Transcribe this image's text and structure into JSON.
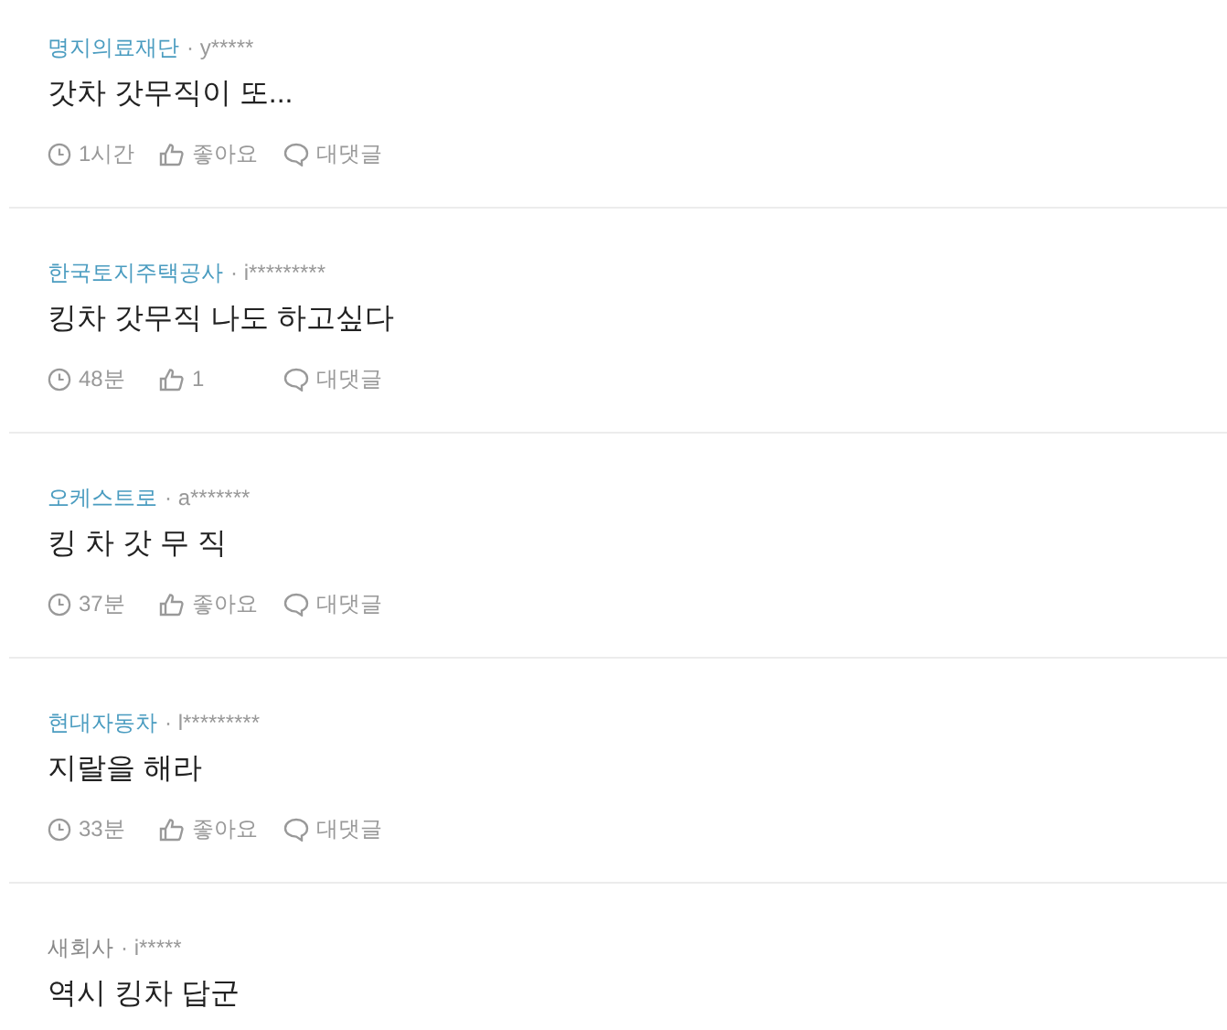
{
  "comments": [
    {
      "company": "명지의료재단",
      "color": "#4a9cc0",
      "author": "· y*****",
      "text": "갓차 갓무직이 또...",
      "time": "1시간",
      "likes": "좋아요",
      "reply": "대댓글"
    },
    {
      "company": "한국토지주택공사",
      "color": "#4a9cc0",
      "author": "· i*********",
      "text": "킹차 갓무직 나도 하고싶다",
      "time": "48분",
      "likes": "1",
      "reply": "대댓글"
    },
    {
      "company": "오케스트로",
      "color": "#4a9cc0",
      "author": "· a*******",
      "text": "킹 차 갓 무 직",
      "time": "37분",
      "likes": "좋아요",
      "reply": "대댓글"
    },
    {
      "company": "현대자동차",
      "color": "#4a9cc0",
      "author": "· l*********",
      "text": "지랄을 해라",
      "time": "33분",
      "likes": "좋아요",
      "reply": "대댓글"
    },
    {
      "company": "새회사",
      "color": "#888888",
      "author": "· i*****",
      "text": "역시 킹차 답군"
    }
  ]
}
